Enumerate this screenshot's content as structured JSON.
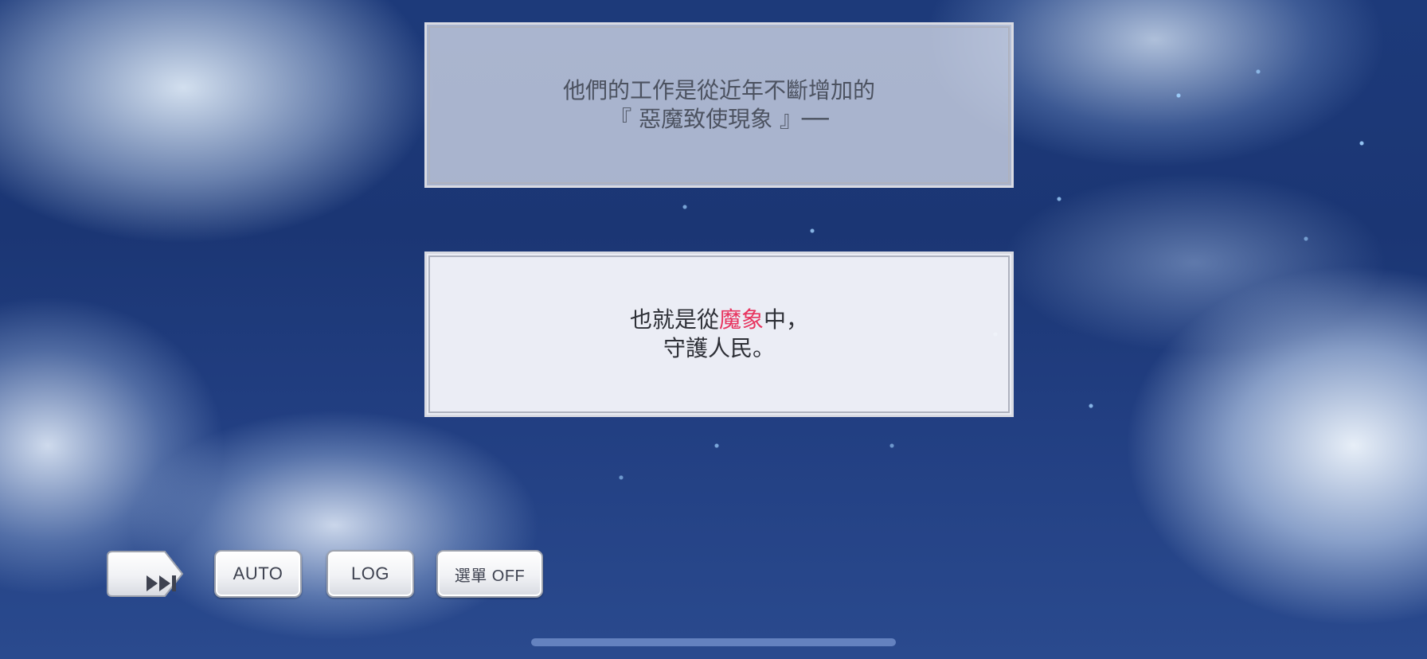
{
  "narration": {
    "line1": "他們的工作是從近年不斷增加的",
    "line2": "『 惡魔致使現象 』──"
  },
  "dialogue": {
    "line1_before": "也就是從",
    "line1_highlight": "魔象",
    "line1_after": "中，",
    "line2": "守護人民。",
    "highlight_color": "#e8345f"
  },
  "controls": {
    "skip_icon": "fast-forward-skip-icon",
    "auto_label": "AUTO",
    "log_label": "LOG",
    "menu_label": "選單 OFF"
  }
}
